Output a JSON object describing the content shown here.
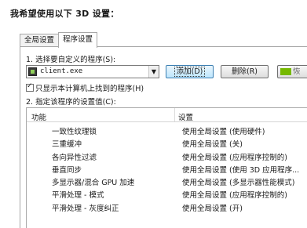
{
  "heading": "我希望使用以下 3D 设置：",
  "tabs": [
    {
      "label": "全局设置",
      "active": false
    },
    {
      "label": "程序设置",
      "active": true
    }
  ],
  "step1": {
    "label": "1. 选择要自定义的程序(S):",
    "selected_program": "client.exe",
    "add_button": "添加(D)",
    "remove_button": "删除(R)",
    "third_button": "恢"
  },
  "checkbox": {
    "label": "只显示本计算机上找到的程序(H)",
    "checked": true
  },
  "step2": {
    "label": "2. 指定该程序的设置值(C):"
  },
  "table": {
    "columns": [
      "功能",
      "设置"
    ],
    "rows": [
      {
        "feature": "一致性纹理锁",
        "setting": "使用全局设置 (使用硬件)"
      },
      {
        "feature": "三重缓冲",
        "setting": "使用全局设置 (关)"
      },
      {
        "feature": "各向异性过滤",
        "setting": "使用全局设置 (应用程序控制的)"
      },
      {
        "feature": "垂直同步",
        "setting": "使用全局设置 (使用 3D 应用程序..."
      },
      {
        "feature": "多显示器/混合 GPU 加速",
        "setting": "使用全局设置 (多显示器性能模式)"
      },
      {
        "feature": "平滑处理 - 模式",
        "setting": "使用全局设置 (应用程序控制的)"
      },
      {
        "feature": "平滑处理 - 灰度纠正",
        "setting": "使用全局设置 (开)"
      }
    ]
  },
  "colors": {
    "accent_button_border": "#3c7fb1",
    "accent_button_fill": "#bee6fd",
    "nvidia_green": "#76b900"
  },
  "icons": {
    "program": "program-exe-icon",
    "dropdown": "chevron-down-icon",
    "checkbox": "checkmark-icon",
    "vendor": "nvidia-logo-icon"
  }
}
